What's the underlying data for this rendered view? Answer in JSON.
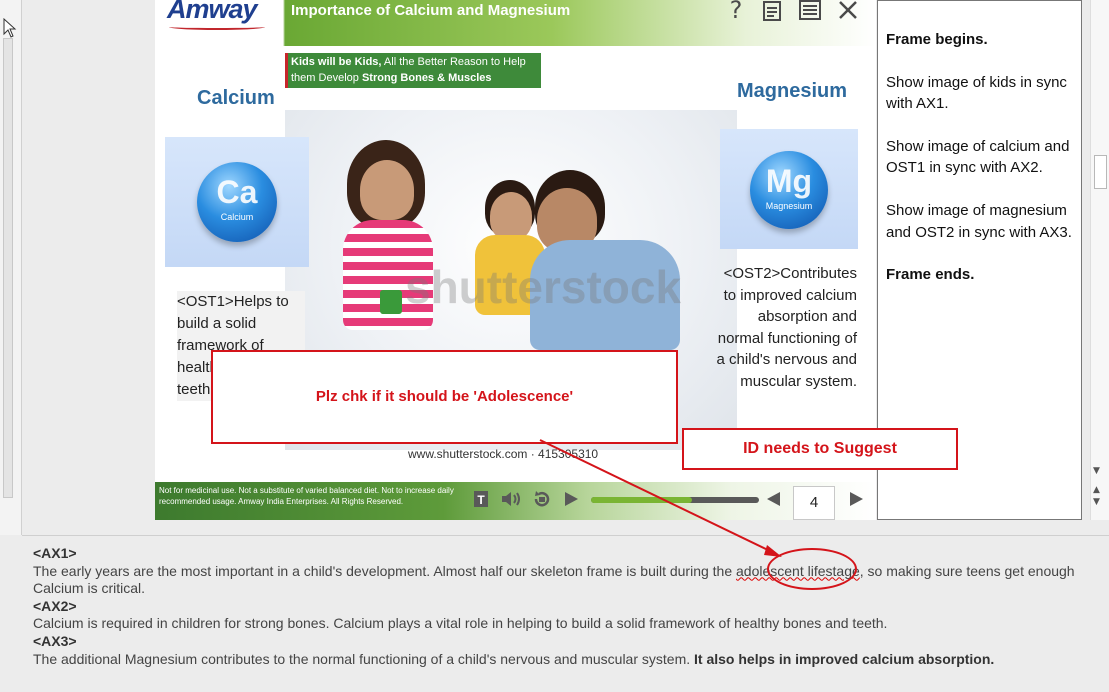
{
  "slide": {
    "logo": "Amway",
    "title": "Importance of Calcium and Magnesium",
    "banner_bold": "Kids will be Kids,",
    "banner_text": " All the Better Reason to Help them Develop ",
    "banner_bold2": "Strong Bones & Muscles",
    "calcium_title": "Calcium",
    "magnesium_title": "Magnesium",
    "ca_symbol": "Ca",
    "ca_name": "Calcium",
    "mg_symbol": "Mg",
    "mg_name": "Magnesium",
    "ost1": "<OST1>Helps to build a solid framework of healthy bones and teeth.",
    "ost2": "<OST2>Contributes to improved calcium absorption and normal functioning of a child's nervous and muscular system.",
    "watermark": "shutterstock",
    "shutter_url": "www.shutterstock.com · 415305310",
    "disclaimer": "Not for medicinal use. Not a substitute of varied balanced diet. Not to increase daily recommended usage. Amway India Enterprises. All Rights Reserved.",
    "page_number": "4",
    "progress": 0.6
  },
  "header_icons": [
    "help-icon",
    "notes-icon",
    "menu-icon",
    "close-icon"
  ],
  "notes": {
    "line1": "Frame begins.",
    "line2": "Show image of kids in sync with AX1.",
    "line3": "Show image of calcium and OST1 in sync with AX2.",
    "line4": "Show image of magnesium and OST2 in sync with AX3.",
    "line5": "Frame ends."
  },
  "annotations": {
    "callout1": "Plz chk if it should be 'Adolescence'",
    "callout2": "ID needs to Suggest"
  },
  "script": {
    "ax1_tag": "<AX1>",
    "ax1_pre": "The early years are the most important in a child's development. Almost half our skeleton frame is built during the ",
    "ax1_word": "adolescent lifestage",
    "ax1_post": ", so making sure teens get enough Calcium is critical.",
    "ax2_tag": "<AX2>",
    "ax2": "Calcium is required in children for strong bones. Calcium plays a vital role in helping to build a solid framework of healthy bones and teeth.",
    "ax3_tag": "<AX3>",
    "ax3": "The additional Magnesium contributes to the normal functioning of a child's nervous and muscular system. ",
    "ax3_bold": "It also helps in improved calcium absorption."
  },
  "colors": {
    "accent_green": "#6aa834",
    "title_blue": "#2e6a9e",
    "annotation_red": "#d4141a"
  }
}
